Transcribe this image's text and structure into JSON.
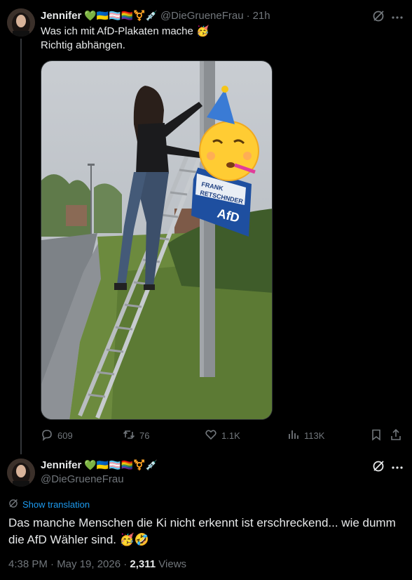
{
  "post1": {
    "author_name": "Jennifer",
    "author_emojis": "💚🇺🇦🏳️‍⚧️🏳️‍🌈⚧️💉",
    "handle": "@DieGrueneFrau",
    "separator": "·",
    "time": "21h",
    "text_line1": "Was ich mit AfD-Plakaten mache 🥳",
    "text_line2": "Richtig abhängen.",
    "media": {
      "sign_line1": "FRANK",
      "sign_line2": "RETSCHNDER",
      "sign_logo": "AfD"
    },
    "actions": {
      "replies": "609",
      "reposts": "76",
      "likes": "1.1K",
      "views": "113K"
    }
  },
  "post2": {
    "author_name": "Jennifer",
    "author_emojis": "💚🇺🇦🏳️‍⚧️🏳️‍🌈⚧️💉",
    "handle": "@DieGrueneFrau",
    "show_translation": "Show translation",
    "text": "Das manche Menschen die Ki nicht erkennt ist erschreckend... wie dumm die AfD Wähler sind. 🥳🤣",
    "timestamp": "4:38 PM · May 19, 2026 · ",
    "views_count": "2,311",
    "views_label": " Views"
  },
  "colors": {
    "background": "#000000",
    "text": "#e7e9ea",
    "muted": "#71767b",
    "link": "#1d9bf0"
  }
}
